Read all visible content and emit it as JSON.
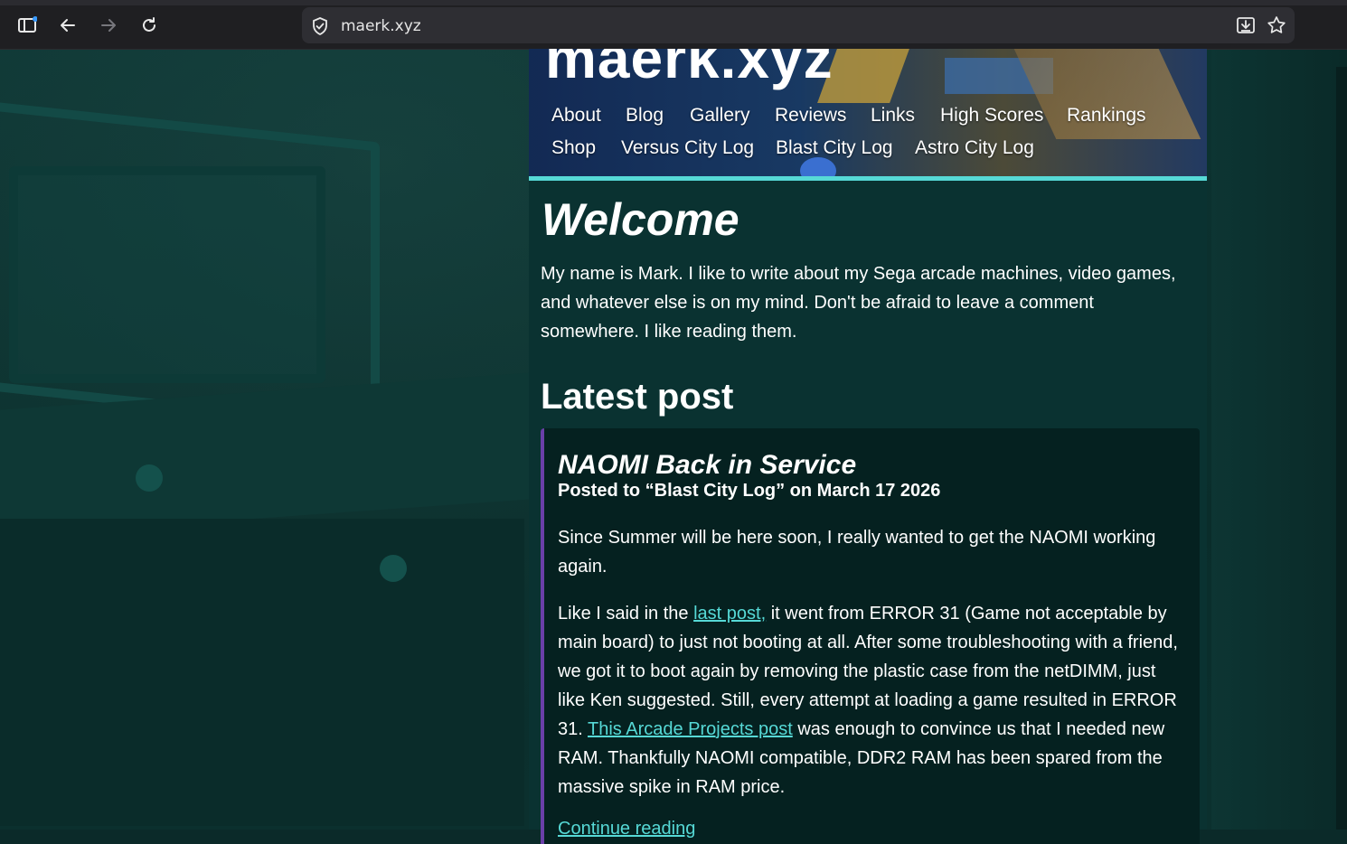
{
  "browser": {
    "url": "maerk.xyz",
    "icons": [
      "sidebar-toggle-icon",
      "back-arrow-icon",
      "forward-arrow-icon",
      "reload-icon",
      "shield-icon",
      "save-to-device-icon",
      "bookmark-star-icon"
    ]
  },
  "site": {
    "title": "maerk.xyz",
    "nav_row1": [
      "About",
      "Blog",
      "Gallery",
      "Reviews",
      "Links",
      "High Scores",
      "Rankings"
    ],
    "nav_row2": [
      "Shop",
      "Versus City Log",
      "Blast City Log",
      "Astro City Log"
    ],
    "accent_color": "#56d9d6"
  },
  "main": {
    "welcome_heading": "Welcome",
    "intro": "My name is Mark. I like to write about my Sega arcade machines, video games, and whatever else is on my mind. Don't be afraid to leave a comment somewhere. I like reading them.",
    "latest_heading": "Latest post"
  },
  "post": {
    "title": "NAOMI Back in Service",
    "meta": "Posted to “Blast City Log” on March 17 2026",
    "p1": "Since Summer will be here soon, I really wanted to get the NAOMI working again.",
    "p2_before": "Like I said in the ",
    "p2_link1": "last post,",
    "p2_mid": " it went from ERROR 31 (Game not acceptable by main board) to just not booting at all. After some troubleshooting with a friend, we got it to boot again by removing the plastic case from the netDIMM, just like Ken suggested. Still, every attempt at loading a game resulted in ERROR 31. ",
    "p2_link2": "This Arcade Projects post",
    "p2_after": " was enough to convince us that I needed new RAM. Thankfully NAOMI compatible, DDR2 RAM has been spared from the massive spike in RAM price.",
    "continue_label": "Continue reading"
  }
}
